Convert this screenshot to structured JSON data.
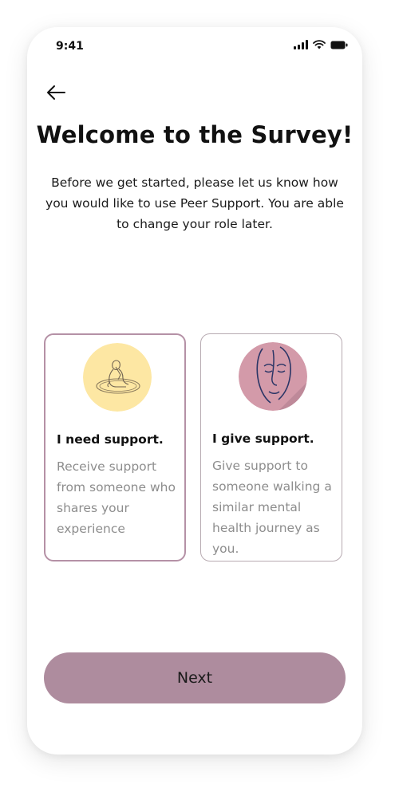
{
  "status_bar": {
    "time": "9:41",
    "icons": [
      "signal-icon",
      "wifi-icon",
      "battery-icon"
    ]
  },
  "header": {
    "back_icon": "arrow-left-icon",
    "title": "Welcome to the Survey!",
    "subtitle": "Before we get started, please let us know how you would like to use Peer Support. You are able to change your role later."
  },
  "options": [
    {
      "title": "I need support.",
      "description": "Receive support from someone who shares your experience",
      "illustration": "person-sitting-illustration",
      "selected": true
    },
    {
      "title": "I give support.",
      "description": "Give support to someone walking a similar mental health journey as you.",
      "illustration": "face-line-art-illustration",
      "selected": false
    }
  ],
  "footer": {
    "next_label": "Next"
  },
  "colors": {
    "accent": "#ae8c9e",
    "selected_border": "#b591a6",
    "illustration_yellow": "#fde7a3",
    "illustration_pink": "#d39aa9"
  }
}
